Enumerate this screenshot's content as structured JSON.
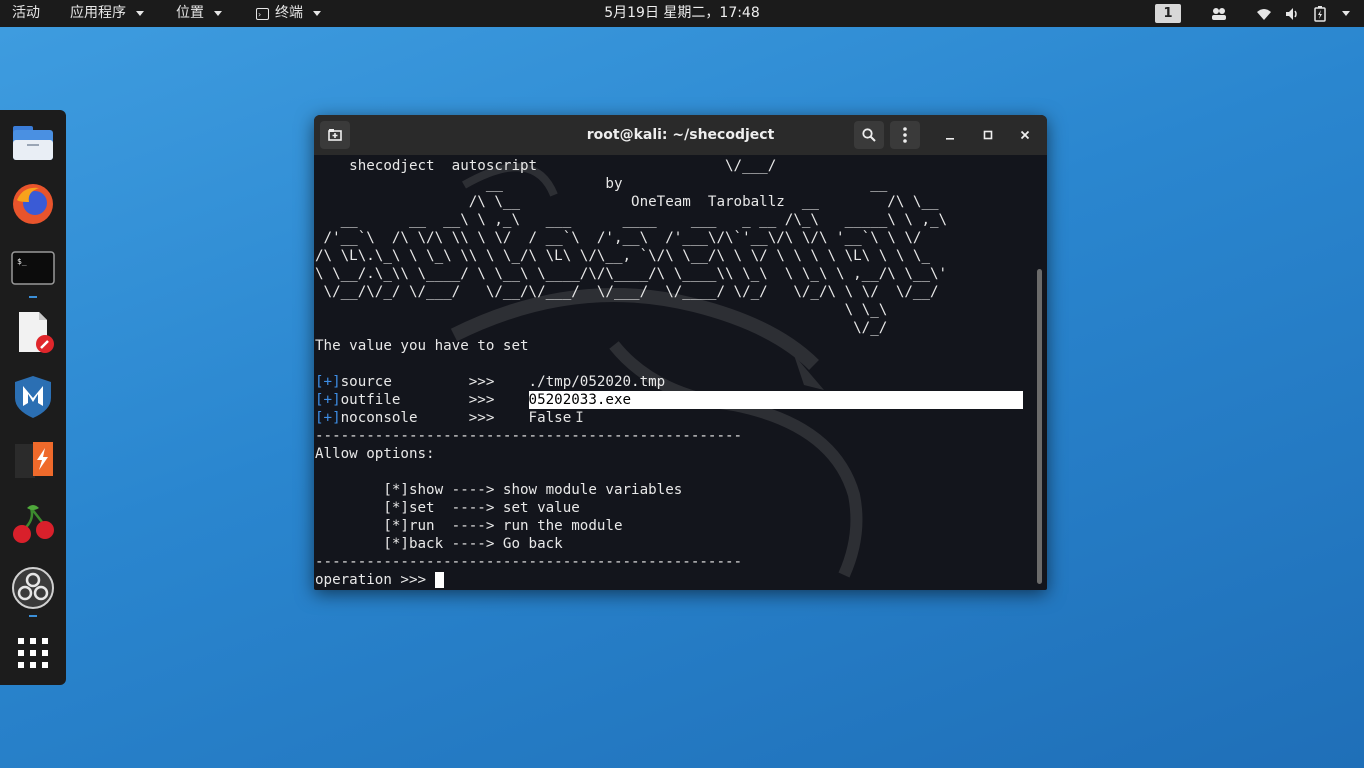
{
  "topbar": {
    "activities": "活动",
    "applications": "应用程序",
    "places": "位置",
    "terminal": "终端",
    "clock": "5月19日 星期二，17:48",
    "workspace": "1"
  },
  "dock": {
    "items": [
      "files-icon",
      "firefox-icon",
      "terminal-icon",
      "text-editor-icon",
      "metasploit-icon",
      "burpsuite-icon",
      "cherrytree-icon",
      "obs-icon",
      "app-grid-icon"
    ]
  },
  "window": {
    "title": "root@kali: ~/shecodject"
  },
  "terminal": {
    "banner": [
      "    shecodject  autoscript                      \\/___/",
      "                    __            by                             __",
      "                  /\\ \\__             OneTeam  Taroballz  __        /\\ \\__",
      "   __      __  __\\ \\ ,_\\   ___      ____    ___   _ __ /\\_\\   _____\\ \\ ,_\\",
      " /'__`\\  /\\ \\/\\ \\\\ \\ \\/  / __`\\  /',__\\  /'___\\/\\`'__\\/\\ \\/\\ '__`\\ \\ \\/",
      "/\\ \\L\\.\\_\\ \\ \\_\\ \\\\ \\ \\_/\\ \\L\\ \\/\\__, `\\/\\ \\__/\\ \\ \\/ \\ \\ \\ \\ \\L\\ \\ \\ \\_",
      "\\ \\__/.\\_\\\\ \\____/ \\ \\__\\ \\____/\\/\\____/\\ \\____\\\\ \\_\\  \\ \\_\\ \\ ,__/\\ \\__\\'",
      " \\/__/\\/_/ \\/___/   \\/__/\\/___/  \\/___/  \\/____/ \\/_/   \\/_/\\ \\ \\/  \\/__/",
      "                                                              \\ \\_\\",
      "                                                               \\/_/"
    ],
    "value_heading": "The value you have to set",
    "values": [
      {
        "prefix": "[+]",
        "name": "source         >>>    ",
        "value": "./tmp/052020.tmp"
      },
      {
        "prefix": "[+]",
        "name": "outfile        >>>    ",
        "value": "05202033.exe"
      },
      {
        "prefix": "[+]",
        "name": "noconsole      >>>    ",
        "value": "False"
      }
    ],
    "divider": "--------------------------------------------------",
    "options_heading": "Allow options:",
    "options": [
      "        [*]show ----> show module variables",
      "        [*]set  ----> set value",
      "        [*]run  ----> run the module",
      "        [*]back ----> Go back"
    ],
    "prompt": "operation >>> "
  }
}
